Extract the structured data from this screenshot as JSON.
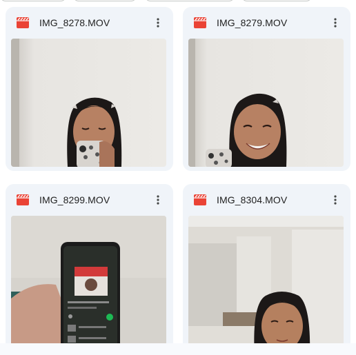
{
  "files": [
    {
      "name": "IMG_8278.MOV",
      "icon": "video-file-icon",
      "menu_icon": "more-vert-icon"
    },
    {
      "name": "IMG_8279.MOV",
      "icon": "video-file-icon",
      "menu_icon": "more-vert-icon"
    },
    {
      "name": "IMG_8299.MOV",
      "icon": "video-file-icon",
      "menu_icon": "more-vert-icon"
    },
    {
      "name": "IMG_8304.MOV",
      "icon": "video-file-icon",
      "menu_icon": "more-vert-icon"
    }
  ],
  "colors": {
    "card_bg": "#f0f4f9",
    "icon_red": "#ea4335",
    "text": "#1f1f1f"
  }
}
